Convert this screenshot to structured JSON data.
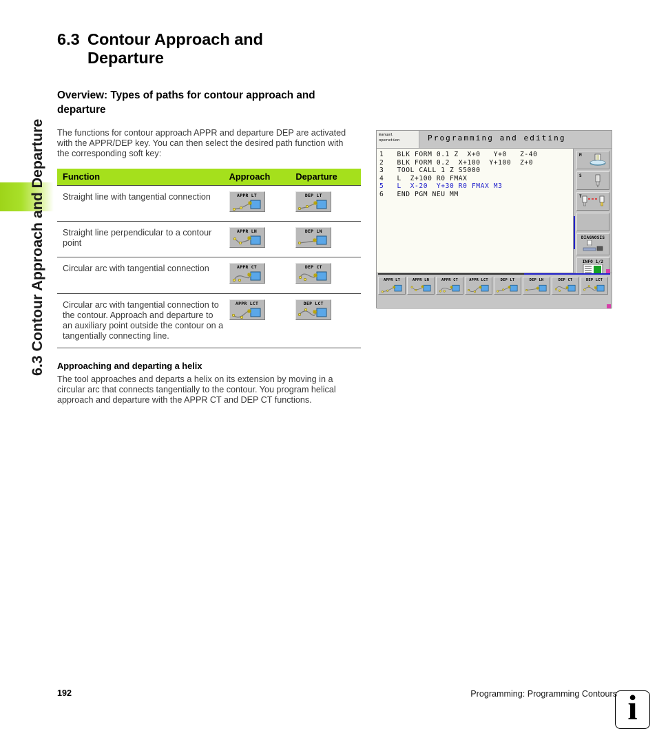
{
  "side_tab": {
    "label": "6.3 Contour Approach and Departure",
    "band_color": "#a5e01c"
  },
  "section": {
    "number": "6.3",
    "title": "Contour Approach and Departure",
    "subtitle": "Overview: Types of paths for contour approach and departure",
    "intro": "The functions for contour approach APPR and departure DEP are activated with the APPR/DEP key. You can then select the desired path function with the corresponding soft key:"
  },
  "table": {
    "headers": [
      "Function",
      "Approach",
      "Departure"
    ],
    "header_bg": "#a5e01c",
    "rows": [
      {
        "function": "Straight line with tangential connection",
        "approach_key": "APPR LT",
        "departure_key": "DEP LT"
      },
      {
        "function": "Straight line perpendicular to a contour point",
        "approach_key": "APPR LN",
        "departure_key": "DEP LN"
      },
      {
        "function": "Circular arc with tangential connection",
        "approach_key": "APPR CT",
        "departure_key": "DEP CT"
      },
      {
        "function": "Circular arc with tangential connection to the contour. Approach and departure to an auxiliary point outside the contour on a tangentially connecting line.",
        "approach_key": "APPR LCT",
        "departure_key": "DEP LCT"
      }
    ]
  },
  "helix": {
    "heading": "Approaching and departing a helix",
    "body": "The tool approaches and departs a helix on its extension by moving in a circular arc that connects tangentially to the contour. You program helical approach and departure with the APPR CT and DEP CT functions."
  },
  "tnc": {
    "mode_line1": "manual",
    "mode_line2": "operation",
    "title": "Programming and editing",
    "program_lines": [
      {
        "text": "1   BLK FORM 0.1 Z  X+0   Y+0   Z-40",
        "highlight": false
      },
      {
        "text": "2   BLK FORM 0.2  X+100  Y+100  Z+0",
        "highlight": false
      },
      {
        "text": "3   TOOL CALL 1 Z S5000",
        "highlight": false
      },
      {
        "text": "4   L  Z+100 R0 FMAX",
        "highlight": false
      },
      {
        "text": "5   L  X-20  Y+30 R0 FMAX M3",
        "highlight": true
      },
      {
        "text": "6   END PGM NEU MM",
        "highlight": false
      }
    ],
    "highlight_color": "#2222cc",
    "status_boxes": [
      {
        "label": "M",
        "icon": "spindle-icon"
      },
      {
        "label": "S",
        "icon": "tool-icon"
      },
      {
        "label": "T",
        "icon": "tool-change-icon"
      },
      {
        "label": "",
        "icon": ""
      },
      {
        "label": "DIAGNOSIS",
        "icon": "diagnosis-icon"
      },
      {
        "label": "INFO 1/2",
        "icon": "info-doc-icon"
      }
    ],
    "softkeys": [
      "APPR LT",
      "APPR LN",
      "APPR CT",
      "APPR LCT",
      "DEP LT",
      "DEP LN",
      "DEP CT",
      "DEP LCT"
    ]
  },
  "footer": {
    "page": "192",
    "text": "Programming: Programming Contours",
    "info_glyph": "i"
  }
}
